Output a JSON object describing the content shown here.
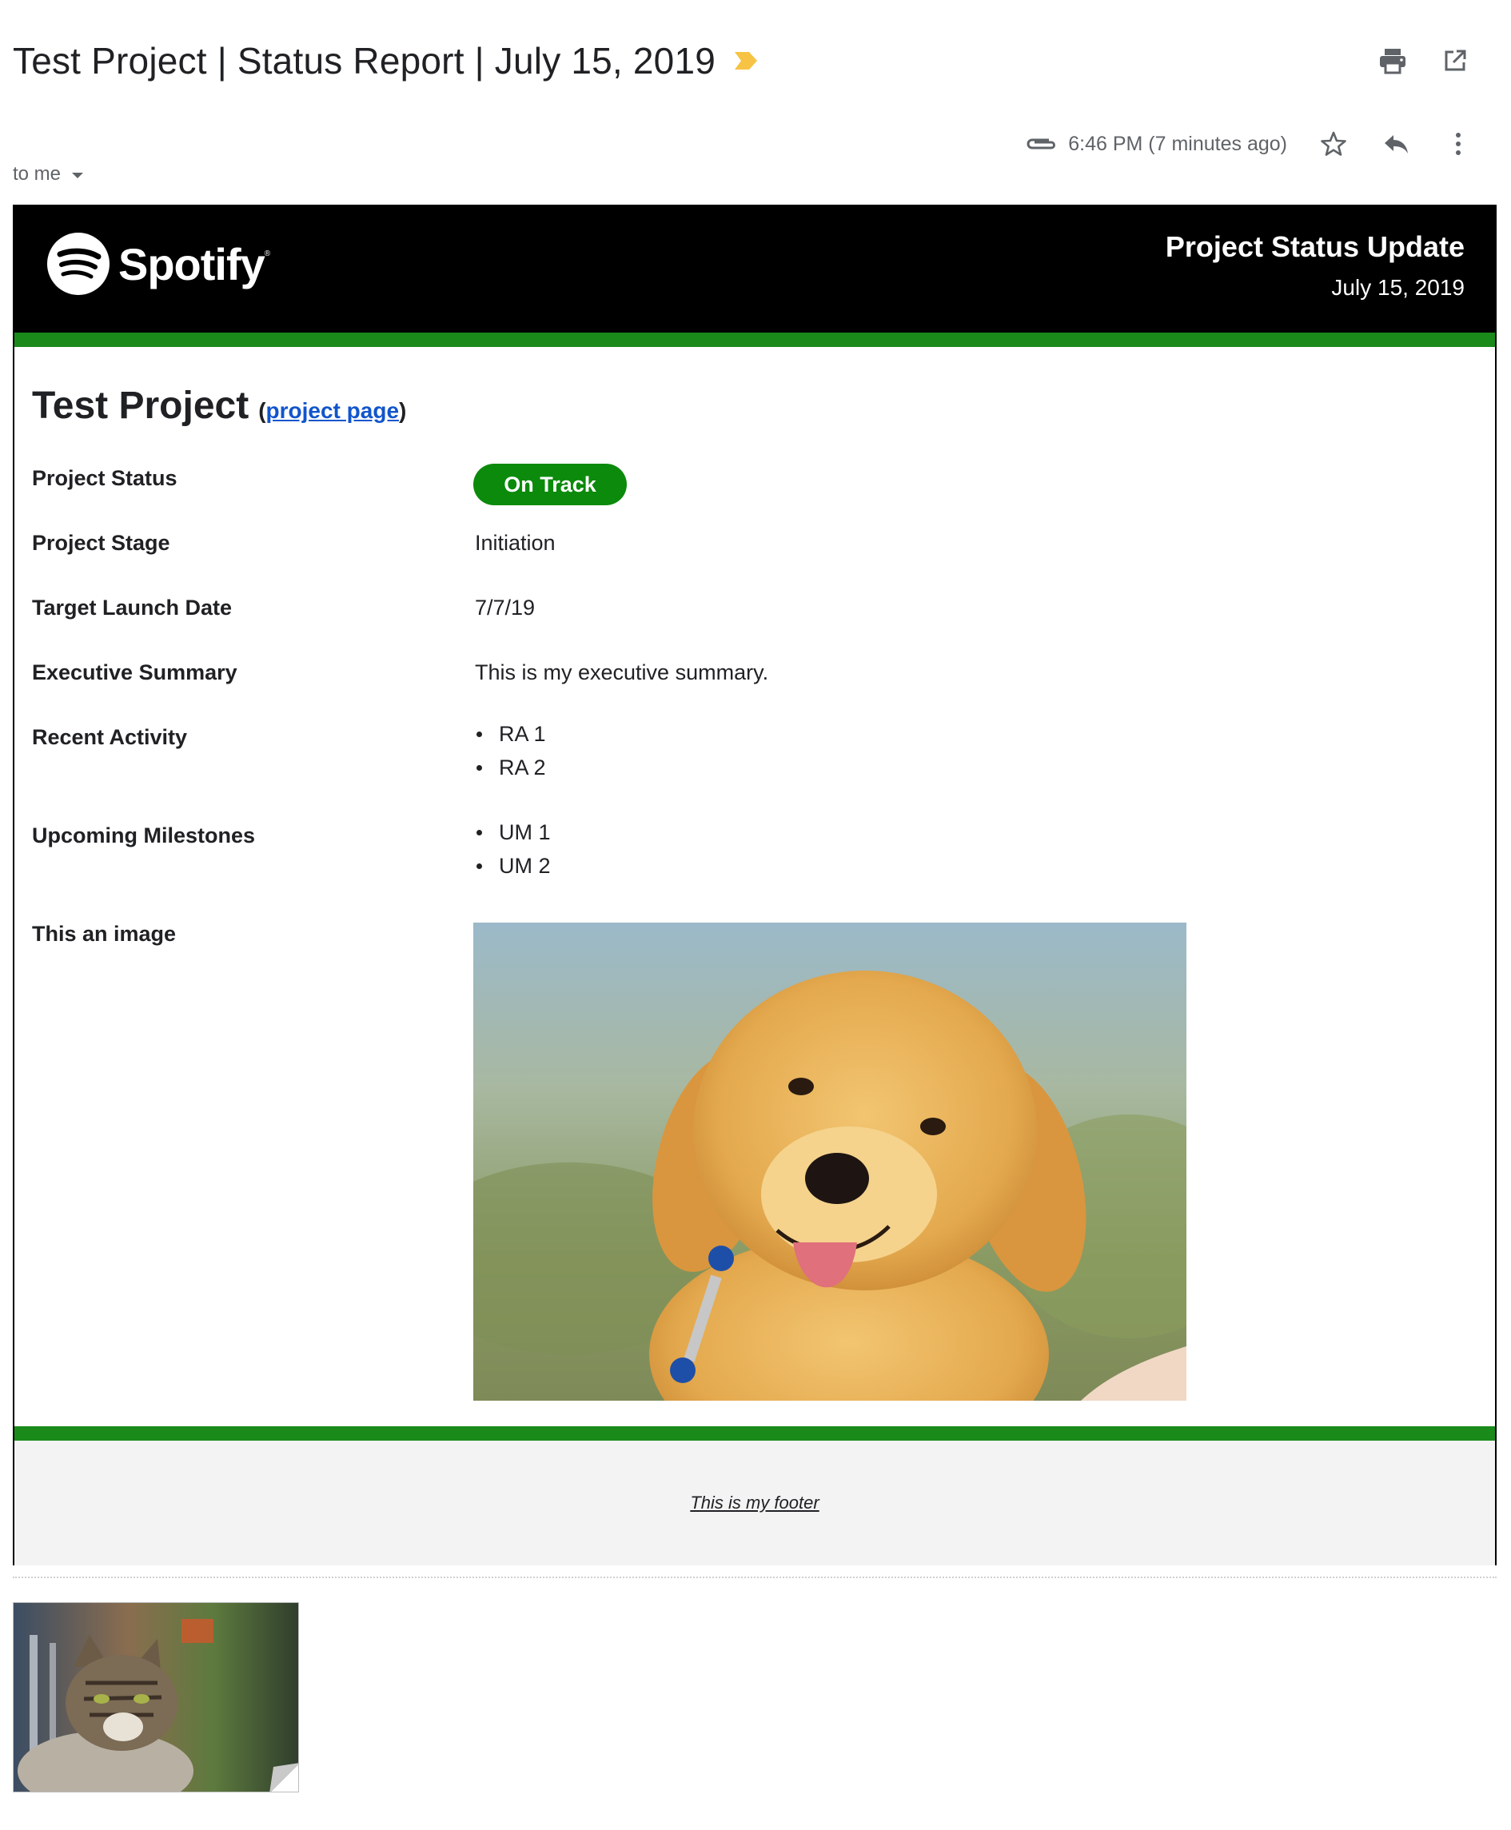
{
  "email": {
    "subject": "Test Project | Status Report | July 15, 2019",
    "time": "6:46 PM (7 minutes ago)",
    "recipient": "to me",
    "icons": [
      "importance-marker-icon",
      "print-icon",
      "open-in-new-window-icon",
      "paperclip-icon",
      "star-icon",
      "reply-icon",
      "more-vertical-icon",
      "caret-down-icon"
    ]
  },
  "banner": {
    "brand": "Spotify",
    "title": "Project Status Update",
    "date": "July 15, 2019",
    "brand_color": "#000000",
    "accent_color": "#1a8a1a"
  },
  "project": {
    "name": "Test Project",
    "link_open": "(",
    "link_text": "project page",
    "link_close": ")"
  },
  "rows": {
    "status_label": "Project Status",
    "status_value": "On Track",
    "status_color": "#0b8a0b",
    "stage_label": "Project Stage",
    "stage_value": "Initiation",
    "launch_label": "Target Launch Date",
    "launch_value": "7/7/19",
    "summary_label": "Executive Summary",
    "summary_value": "This is my executive summary.",
    "activity_label": "Recent Activity",
    "activity_items": [
      "RA 1",
      "RA 2"
    ],
    "milestones_label": "Upcoming Milestones",
    "milestones_items": [
      "UM 1",
      "UM 2"
    ],
    "image_label": "This an image"
  },
  "footer": {
    "text": "This is my footer"
  }
}
